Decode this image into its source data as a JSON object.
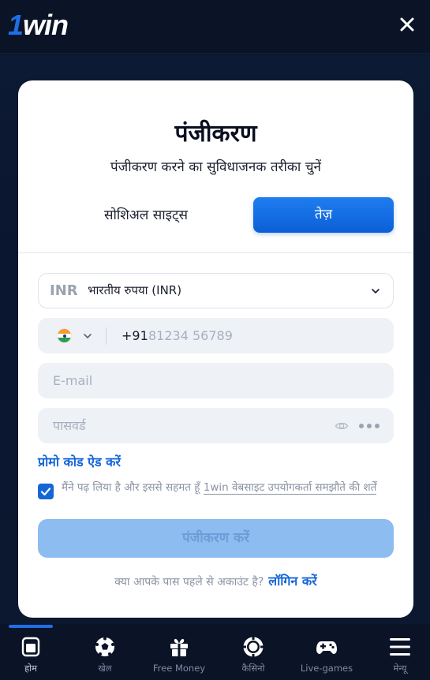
{
  "header": {
    "logo_text": "1win",
    "close_label": "×"
  },
  "registration": {
    "title": "पंजीकरण",
    "subtitle": "पंजीकरण करने का सुविधाजनक तरीका चुनें",
    "tabs": {
      "social": "सोशिअल साइट्स",
      "fast": "तेज़"
    },
    "currency": {
      "code": "INR",
      "name": "भारतीय रुपया (INR)"
    },
    "phone": {
      "country_flag": "india-flag",
      "dial_code": "+91",
      "placeholder": "81234 56789"
    },
    "email": {
      "placeholder": "E-mail"
    },
    "password": {
      "placeholder": "पासवर्ड"
    },
    "promo_link": "प्रोमो कोड ऐड करें",
    "agreement": {
      "checked": true,
      "text_prefix": "मैंने पढ़ लिया है और इससे सहमत हूँ ",
      "link_text": "1win वेबसाइट उपयोगकर्ता समझौते की शर्तें"
    },
    "submit_label": "पंजीकरण करें",
    "login_prompt": "क्या आपके पास पहले से अकाउंट है?",
    "login_link": "लॉगिन करें"
  },
  "bottom_nav": {
    "items": [
      {
        "label": "होम",
        "icon": "home-icon",
        "active": true
      },
      {
        "label": "खेल",
        "icon": "soccer-ball-icon",
        "active": false
      },
      {
        "label": "Free Money",
        "icon": "gift-icon",
        "active": false
      },
      {
        "label": "कैसिनो",
        "icon": "casino-chip-icon",
        "active": false
      },
      {
        "label": "Live-games",
        "icon": "gamepad-icon",
        "active": false
      },
      {
        "label": "मेन्यू",
        "icon": "menu-icon",
        "active": false
      }
    ]
  },
  "colors": {
    "background": "#0a1428",
    "accent": "#1466d8",
    "card": "#ffffff"
  }
}
